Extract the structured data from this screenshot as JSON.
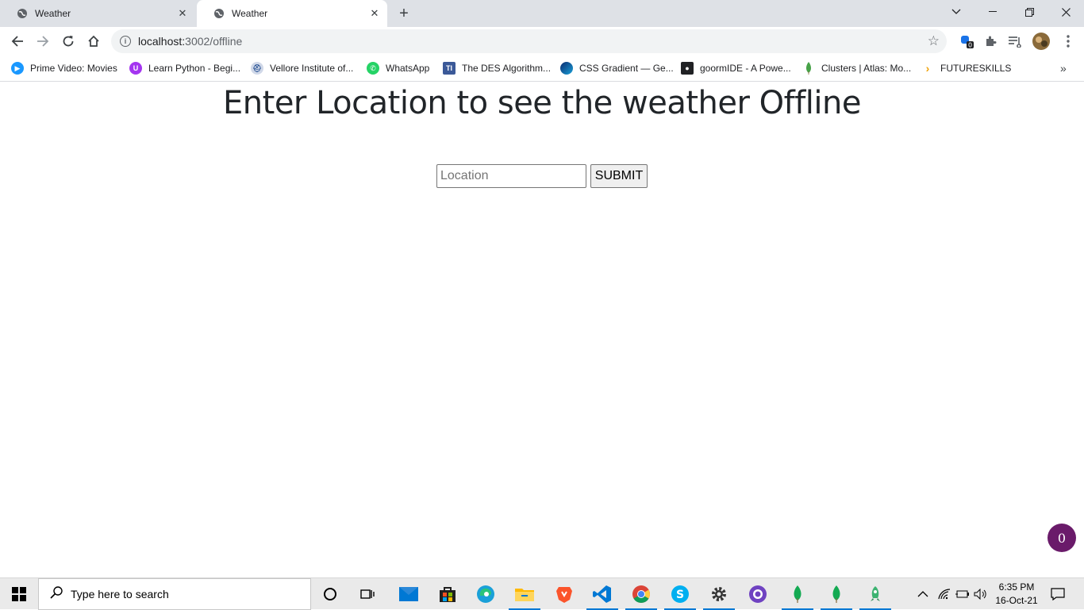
{
  "browser": {
    "tabs": [
      {
        "title": "Weather",
        "active": false
      },
      {
        "title": "Weather",
        "active": true
      }
    ],
    "url_host": "localhost:",
    "url_path": "3002/offline",
    "extension_badge": "0",
    "bookmarks": [
      {
        "label": "Prime Video: Movies",
        "icon": "prime-video-icon",
        "color": "#1a98ff"
      },
      {
        "label": "Learn Python - Begi...",
        "icon": "learn-python-icon",
        "color": "#a435f0"
      },
      {
        "label": "Vellore Institute of...",
        "icon": "vit-icon",
        "color": "#1e4a8f"
      },
      {
        "label": "WhatsApp",
        "icon": "whatsapp-icon",
        "color": "#25d366"
      },
      {
        "label": "The DES Algorithm...",
        "icon": "tutorialspoint-icon",
        "color": "#3b5998"
      },
      {
        "label": "CSS Gradient — Ge...",
        "icon": "css-gradient-icon",
        "color": "#0b2a6f"
      },
      {
        "label": "goormIDE - A Powe...",
        "icon": "goorm-icon",
        "color": "#202124"
      },
      {
        "label": "Clusters | Atlas: Mo...",
        "icon": "mongodb-leaf-icon",
        "color": "#47a248"
      },
      {
        "label": "FUTURESKILLS",
        "icon": "futureskills-icon",
        "color": "#f0a30a"
      }
    ]
  },
  "page": {
    "heading": "Enter Location to see the weather Offline",
    "location_placeholder": "Location",
    "submit_label": "SUBMIT",
    "notification_count": "0"
  },
  "taskbar": {
    "search_placeholder": "Type here to search",
    "time": "6:35 PM",
    "date": "16-Oct-21"
  },
  "colors": {
    "chrome_frame": "#dee1e6",
    "badge": "#6a1b6a",
    "heading_text": "#212529"
  }
}
